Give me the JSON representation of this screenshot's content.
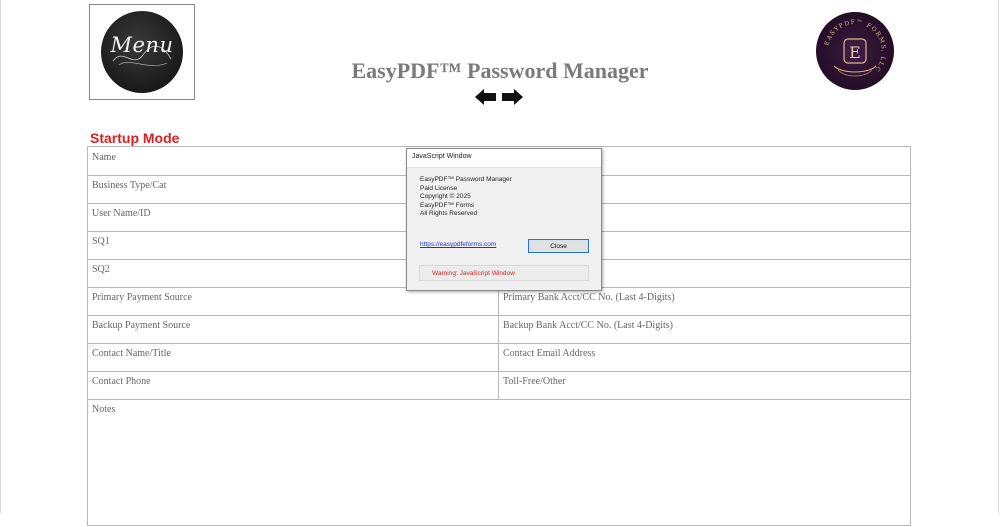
{
  "menu": {
    "label": "Menu"
  },
  "header": {
    "title": "EasyPDF™ Password Manager"
  },
  "logo": {
    "brand_text": "EASYPDF™ FORMS, LLC",
    "letter": "E"
  },
  "section": {
    "title": "Startup Mode"
  },
  "form": {
    "rows": [
      {
        "left": "Name",
        "right": ""
      },
      {
        "left": "Business Type/Cat",
        "right": ""
      },
      {
        "left": "User Name/ID",
        "right": ""
      },
      {
        "left": "SQ1",
        "right": ""
      },
      {
        "left": "SQ2",
        "right": ""
      },
      {
        "left": "Primary Payment Source",
        "right": "Primary Bank Acct/CC No. (Last 4-Digits)"
      },
      {
        "left": "Backup Payment Source",
        "right": "Backup Bank Acct/CC No. (Last 4-Digits)"
      },
      {
        "left": "Contact Name/Title",
        "right": "Contact Email Address"
      },
      {
        "left": "Contact Phone",
        "right": "Toll-Free/Other"
      }
    ],
    "notes_label": "Notes"
  },
  "dialog": {
    "title": "JavaScript Window",
    "lines": [
      "EasyPDF™ Password Manager",
      "Paid License",
      "Copyright © 2025",
      "EasyPDF™ Forms",
      "All Rights Reserved"
    ],
    "link": "https://easypdfeforms.com",
    "close_label": "Close",
    "warning": "Warning: JavaScript Window"
  },
  "colors": {
    "section_title": "#d91f1f",
    "title": "#7a7a7a",
    "link": "#1a37c8",
    "warning": "#d12424",
    "logo_bg": "#2a1030",
    "logo_gold": "#d9b98a"
  },
  "icons": {
    "back": "arrow-left-icon",
    "forward": "arrow-right-icon"
  }
}
